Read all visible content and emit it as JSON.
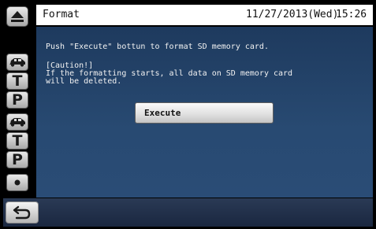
{
  "window": {
    "title": "Format",
    "date": "11/27/2013(Wed)",
    "time": "15:26"
  },
  "sidebar": {
    "items": [
      {
        "icon": "eject-icon"
      },
      {
        "icon": "car-icon"
      },
      {
        "icon": "letter-t-icon",
        "label": "T"
      },
      {
        "icon": "letter-p-icon",
        "label": "P"
      },
      {
        "icon": "car-icon"
      },
      {
        "icon": "letter-t-icon",
        "label": "T"
      },
      {
        "icon": "letter-p-icon",
        "label": "P"
      },
      {
        "icon": "dot-icon"
      }
    ]
  },
  "main": {
    "instruction": "Push \"Execute\" bottun to format SD memory card.",
    "caution_title": "[Caution!]",
    "caution_line1": "If the formatting starts, all data on SD memory card",
    "caution_line2": "will be deleted.",
    "execute_label": "Execute"
  },
  "bottom": {
    "back_icon": "return-arrow-icon"
  }
}
